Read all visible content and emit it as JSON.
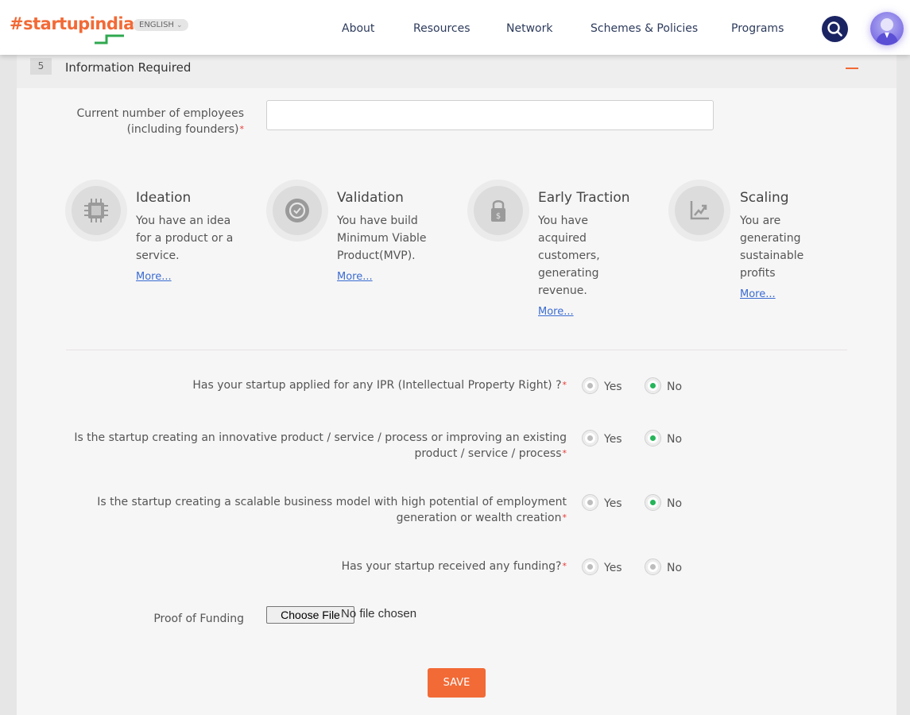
{
  "header": {
    "logo_hash": "#",
    "logo_name": "startupindia",
    "language": "ENGLISH",
    "nav": [
      "About",
      "Resources",
      "Network",
      "Schemes & Policies",
      "Programs"
    ],
    "search_icon": "search-icon",
    "avatar_icon": "user-avatar"
  },
  "section": {
    "step": "5",
    "title": "Information Required",
    "collapse_icon": "minus-icon"
  },
  "employees": {
    "label_line1": "Current number of employees",
    "label_line2": "(including founders)",
    "required": "*",
    "value": ""
  },
  "stages": [
    {
      "title": "Ideation",
      "desc": [
        "You have an idea",
        "for a product or a",
        "service."
      ],
      "more": "More...",
      "icon": "chip-icon"
    },
    {
      "title": "Validation",
      "desc": [
        "You have build",
        "Minimum Viable",
        "Product(MVP)."
      ],
      "more": "More...",
      "icon": "check-circle-icon"
    },
    {
      "title": "Early Traction",
      "desc": [
        "You have",
        "acquired",
        "customers,",
        "generating",
        "revenue."
      ],
      "more": "More...",
      "icon": "money-lock-icon"
    },
    {
      "title": "Scaling",
      "desc": [
        "You are",
        "generating",
        "sustainable",
        "profits"
      ],
      "more": "More...",
      "icon": "growth-chart-icon"
    }
  ],
  "questions": [
    {
      "line1": "Has your startup applied for any IPR (Intellectual Property Right) ?",
      "line2": "",
      "yes": "Yes",
      "no": "No",
      "selected": "No"
    },
    {
      "line1": "Is the startup creating an innovative product / service / process or improving an existing",
      "line2": "product / service / process",
      "yes": "Yes",
      "no": "No",
      "selected": "No"
    },
    {
      "line1": "Is the startup creating a scalable business model with high potential of employment",
      "line2": "generation or wealth creation",
      "yes": "Yes",
      "no": "No",
      "selected": "No"
    },
    {
      "line1": "Has your startup received any funding?",
      "line2": "",
      "yes": "Yes",
      "no": "No",
      "selected": ""
    }
  ],
  "proof": {
    "label": "Proof of Funding",
    "button": "Choose File",
    "status": "No file chosen"
  },
  "save_label": "SAVE",
  "colors": {
    "accent": "#f26a36",
    "nav_dark": "#1b2463",
    "link": "#3a6cd2",
    "radio_checked": "#26b55a",
    "required": "#e53935"
  }
}
